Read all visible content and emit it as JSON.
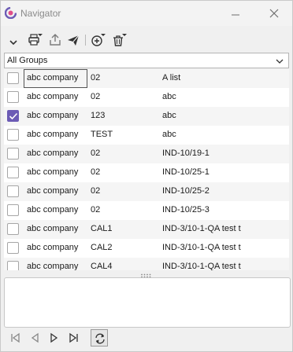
{
  "window": {
    "title": "Navigator",
    "accent_color": "#6c5bb5",
    "icons": {
      "app": "app-logo-icon",
      "minimize": "minimize-icon",
      "close": "close-icon"
    }
  },
  "toolbar": {
    "items": [
      "collapse-chevron-icon",
      "print-icon",
      "export-icon",
      "send-icon",
      "add-icon",
      "delete-icon"
    ]
  },
  "groups": {
    "selected": "All Groups"
  },
  "table": {
    "rows": [
      {
        "checked": false,
        "col1": "abc company",
        "col2": "02",
        "col3": "A list"
      },
      {
        "checked": false,
        "col1": "abc company",
        "col2": "02",
        "col3": "abc"
      },
      {
        "checked": true,
        "col1": "abc company",
        "col2": "123",
        "col3": "abc"
      },
      {
        "checked": false,
        "col1": "abc company",
        "col2": "TEST",
        "col3": "abc"
      },
      {
        "checked": false,
        "col1": "abc company",
        "col2": "02",
        "col3": "IND-10/19-1"
      },
      {
        "checked": false,
        "col1": "abc company",
        "col2": "02",
        "col3": "IND-10/25-1"
      },
      {
        "checked": false,
        "col1": "abc company",
        "col2": "02",
        "col3": "IND-10/25-2"
      },
      {
        "checked": false,
        "col1": "abc company",
        "col2": "02",
        "col3": "IND-10/25-3"
      },
      {
        "checked": false,
        "col1": "abc company",
        "col2": "CAL1",
        "col3": "IND-3/10-1-QA test t"
      },
      {
        "checked": false,
        "col1": "abc company",
        "col2": "CAL2",
        "col3": "IND-3/10-1-QA test t"
      },
      {
        "checked": false,
        "col1": "abc company",
        "col2": "CAL4",
        "col3": "IND-3/10-1-QA test t"
      }
    ]
  },
  "detail": {
    "text": ""
  },
  "navigation": {
    "buttons": [
      "first-icon",
      "previous-icon",
      "next-icon",
      "last-icon",
      "refresh-icon"
    ]
  }
}
